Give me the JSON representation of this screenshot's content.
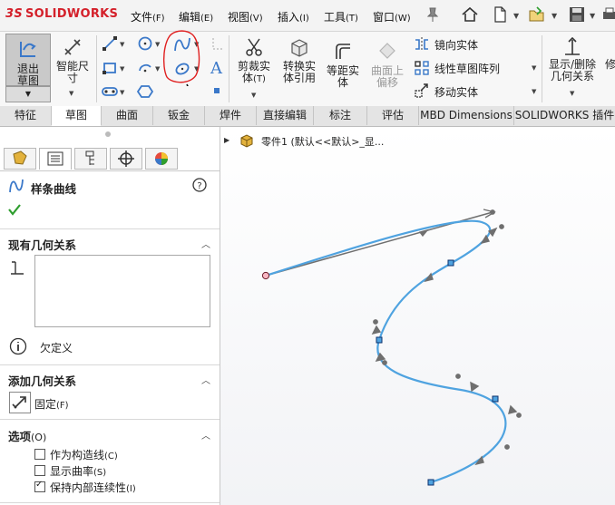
{
  "app": {
    "logo_prefix": "3S",
    "logo_text": "SOLIDWORKS"
  },
  "menubar": [
    {
      "label": "文件",
      "hotkey": "(F)"
    },
    {
      "label": "编辑",
      "hotkey": "(E)"
    },
    {
      "label": "视图",
      "hotkey": "(V)"
    },
    {
      "label": "插入",
      "hotkey": "(I)"
    },
    {
      "label": "工具",
      "hotkey": "(T)"
    },
    {
      "label": "窗口",
      "hotkey": "(W)"
    }
  ],
  "ribbon": {
    "exit_sketch": "退出草图",
    "smart_dimension": "智能尺寸",
    "trim": "剪裁实体",
    "trim_hotkey": "(T)",
    "convert": "转换实体引用",
    "offset": "等距实体",
    "surface_offset": "曲面上偏移",
    "mirror": "镜向实体",
    "linear_pattern": "线性草图阵列",
    "move": "移动实体",
    "display_relations": "显示/删除几何关系",
    "repair": "修"
  },
  "tabs": [
    "特征",
    "草图",
    "曲面",
    "钣金",
    "焊件",
    "直接编辑",
    "标注",
    "评估",
    "MBD Dimensions",
    "SOLIDWORKS 插件"
  ],
  "active_tab": "草图",
  "property_manager": {
    "title": "样条曲线",
    "existing_relations": "现有几何关系",
    "status_text": "欠定义",
    "add_relations": "添加几何关系",
    "fixed_label": "固定",
    "fixed_hotkey": "(F)",
    "options_title": "选项",
    "options_hotkey": "(O)",
    "options": [
      {
        "label": "作为构造线",
        "hotkey": "(C)",
        "checked": false
      },
      {
        "label": "显示曲率",
        "hotkey": "(S)",
        "checked": false
      },
      {
        "label": "保持内部连续性",
        "hotkey": "(I)",
        "checked": true
      }
    ]
  },
  "tree": {
    "part_label": "零件1  (默认<<默认>_显..."
  },
  "colors": {
    "accent_red": "#d4202a",
    "spline_blue": "#4fa3e0",
    "annotation_red": "#e02020",
    "active_green": "#2e9e2e"
  }
}
